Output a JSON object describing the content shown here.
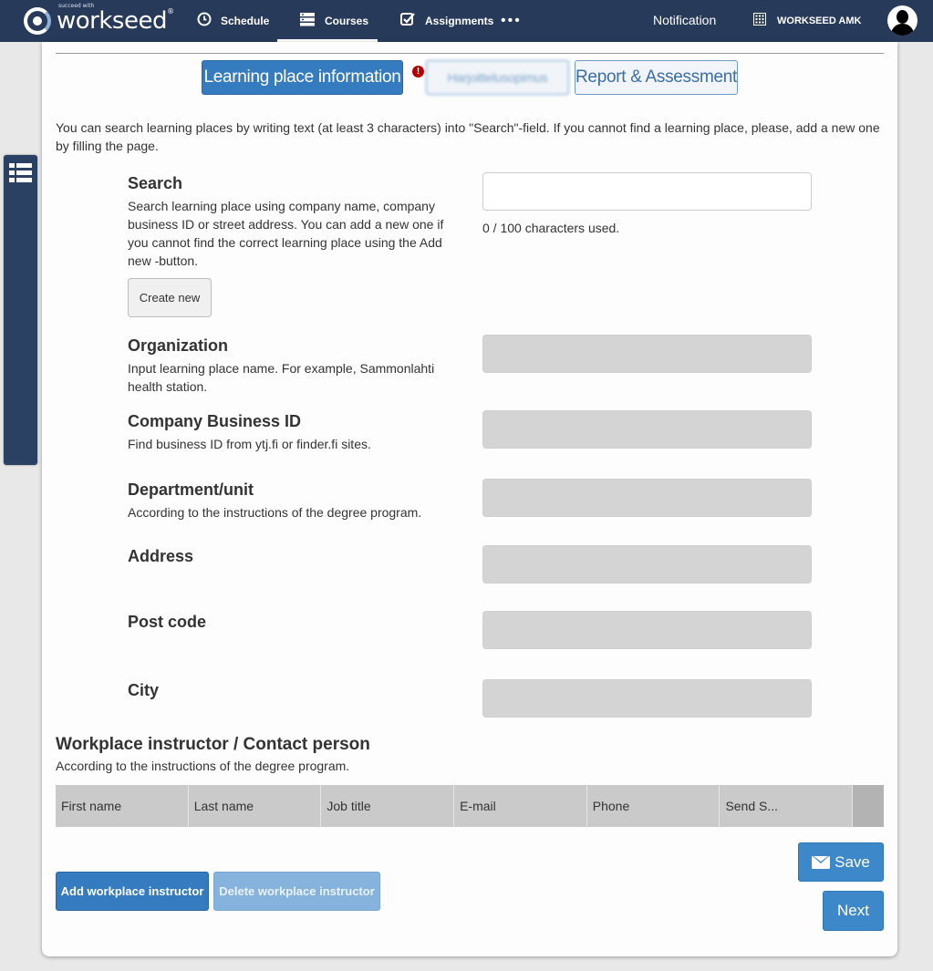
{
  "topbar": {
    "logo_small": "succeed with",
    "logo_text": "workseed",
    "logo_reg": "®",
    "nav": [
      {
        "label": "Schedule",
        "icon": "clock-icon"
      },
      {
        "label": "Courses",
        "icon": "server-stack-icon",
        "active": true
      },
      {
        "label": "Assignments",
        "icon": "checkbox-icon"
      }
    ],
    "more": "•••",
    "notification": "Notification",
    "organization": "WORKSEED AMK"
  },
  "tabs": {
    "learning_place": "Learning place information",
    "agreement": "Harjoittelusopimus",
    "report": "Report & Assessment",
    "warning_glyph": "!"
  },
  "intro": "You can search learning places by writing text (at least 3 characters) into \"Search\"-field. If you cannot find a learning place, please, add a new one by filling the page.",
  "search": {
    "title": "Search",
    "description": "Search learning place using company name, company business ID or street address. You can add a new one if you cannot find the correct learning place using the Add new -button.",
    "value": "",
    "char_count": "0 / 100 characters used.",
    "create_new": "Create new"
  },
  "fields": {
    "organization": {
      "title": "Organization",
      "description": "Input learning place name. For example, Sammonlahti health station."
    },
    "business_id": {
      "title": "Company Business ID",
      "description": "Find business ID from ytj.fi or finder.fi sites."
    },
    "department": {
      "title": "Department/unit",
      "description": "According to the instructions of the degree program."
    },
    "address": {
      "title": "Address"
    },
    "post_code": {
      "title": "Post code"
    },
    "city": {
      "title": "City"
    }
  },
  "instructor": {
    "title": "Workplace instructor / Contact person",
    "description": "According to the instructions of the degree program.",
    "columns": [
      "First name",
      "Last name",
      "Job title",
      "E-mail",
      "Phone",
      "Send S..."
    ],
    "add": "Add workplace instructor",
    "delete": "Delete workplace instructor"
  },
  "actions": {
    "save": "Save",
    "next": "Next"
  },
  "colors": {
    "topbar": "#273a5a",
    "primary": "#357bbf",
    "disabled_button": "#86b2de",
    "disabled_input": "#d4d4d4",
    "warning": "#b50000"
  }
}
